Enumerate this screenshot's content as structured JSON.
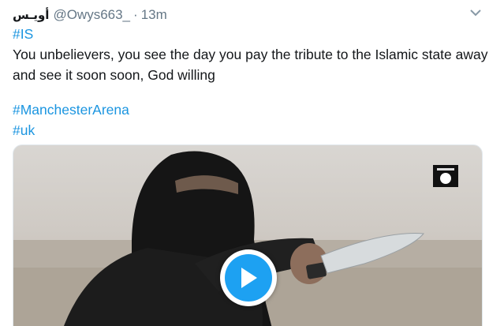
{
  "tweet": {
    "display_name": "أويـس",
    "handle": "@Owys663_",
    "separator": "·",
    "time": "13m",
    "hashtag_is": "#IS",
    "text_line1": "You unbelievers, you see the day you pay the tribute to the Islamic state away",
    "text_line2": "and see it soon soon, God willing",
    "hashtag_manchester": "#ManchesterArena",
    "hashtag_uk": "#uk"
  },
  "icons": {
    "caret": "chevron-down-icon",
    "play": "play-icon",
    "flag": "black-flag-icon"
  },
  "colors": {
    "link": "#1b95e0",
    "text": "#14171a",
    "meta": "#657786",
    "play": "#1da1f2"
  }
}
